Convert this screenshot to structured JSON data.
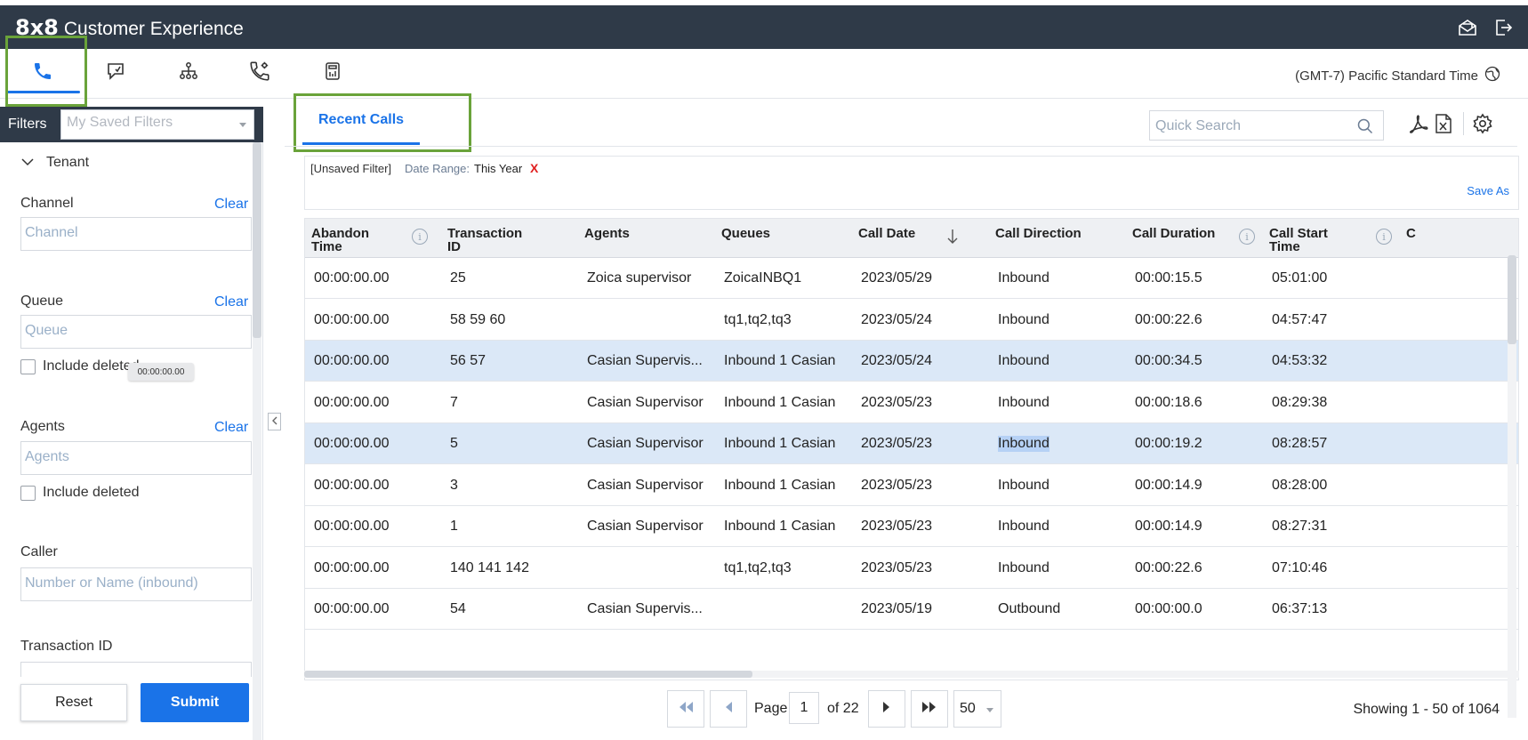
{
  "app": {
    "logo": "8x8",
    "product": "Customer Experience"
  },
  "timezone": "(GMT-7) Pacific Standard Time",
  "icons": {
    "top_right": [
      "mail-open-icon",
      "logout-icon"
    ],
    "tabs": [
      "phone-icon",
      "chat-icon",
      "org-chart-icon",
      "phone-settings-icon",
      "calculator-icon"
    ]
  },
  "accent": "#1a73e8",
  "highlight_box_color": "#6aa33a",
  "sidebar": {
    "filters_label": "Filters",
    "saved_filters_placeholder": "My Saved Filters",
    "tenant_label": "Tenant",
    "channel": {
      "label": "Channel",
      "clear": "Clear",
      "placeholder": "Channel"
    },
    "queue": {
      "label": "Queue",
      "clear": "Clear",
      "placeholder": "Queue",
      "include_deleted": "Include deleted"
    },
    "agents": {
      "label": "Agents",
      "clear": "Clear",
      "placeholder": "Agents",
      "include_deleted": "Include deleted"
    },
    "caller": {
      "label": "Caller",
      "placeholder": "Number or Name (inbound)"
    },
    "transaction_id": {
      "label": "Transaction ID"
    },
    "reset": "Reset",
    "submit": "Submit"
  },
  "main": {
    "tab": "Recent Calls",
    "quick_search_placeholder": "Quick Search",
    "filter": {
      "unsaved": "[Unsaved Filter]",
      "date_range_label": "Date Range:",
      "date_range_value": "This Year",
      "remove": "X",
      "save_as": "Save As"
    },
    "columns": [
      {
        "l1": "Abandon",
        "l2": "Time",
        "info": true
      },
      {
        "l1": "Transaction",
        "l2": "ID",
        "info": false
      },
      {
        "l1": "Agents",
        "l2": "",
        "info": false
      },
      {
        "l1": "Queues",
        "l2": "",
        "info": false
      },
      {
        "l1": "Call Date",
        "l2": "",
        "info": false,
        "sort": "desc"
      },
      {
        "l1": "Call Direction",
        "l2": "",
        "info": false
      },
      {
        "l1": "Call Duration",
        "l2": "",
        "info": true
      },
      {
        "l1": "Call Start",
        "l2": "Time",
        "info": true
      },
      {
        "l1": "C",
        "l2": "",
        "info": false
      }
    ],
    "rows": [
      [
        "00:00:00.00",
        "25",
        "Zoica supervisor",
        "ZoicaINBQ1",
        "2023/05/29",
        "Inbound",
        "00:00:15.5",
        "05:01:00"
      ],
      [
        "00:00:00.00",
        "58 59 60",
        "",
        "tq1,tq2,tq3",
        "2023/05/24",
        "Inbound",
        "00:00:22.6",
        "04:57:47"
      ],
      [
        "00:00:00.00",
        "56 57",
        "Casian Supervis...",
        "Inbound 1 Casian",
        "2023/05/24",
        "Inbound",
        "00:00:34.5",
        "04:53:32"
      ],
      [
        "00:00:00.00",
        "7",
        "Casian Supervisor",
        "Inbound 1 Casian",
        "2023/05/23",
        "Inbound",
        "00:00:18.6",
        "08:29:38"
      ],
      [
        "00:00:00.00",
        "5",
        "Casian Supervisor",
        "Inbound 1 Casian",
        "2023/05/23",
        "Inbound",
        "00:00:19.2",
        "08:28:57"
      ],
      [
        "00:00:00.00",
        "3",
        "Casian Supervisor",
        "Inbound 1 Casian",
        "2023/05/23",
        "Inbound",
        "00:00:14.9",
        "08:28:00"
      ],
      [
        "00:00:00.00",
        "1",
        "Casian Supervisor",
        "Inbound 1 Casian",
        "2023/05/23",
        "Inbound",
        "00:00:14.9",
        "08:27:31"
      ],
      [
        "00:00:00.00",
        "140 141 142",
        "",
        "tq1,tq2,tq3",
        "2023/05/23",
        "Inbound",
        "00:00:22.6",
        "07:10:46"
      ],
      [
        "00:00:00.00",
        "54",
        "Casian Supervis...",
        "",
        "2023/05/19",
        "Outbound",
        "00:00:00.0",
        "06:37:13"
      ]
    ],
    "selected_rows": [
      2,
      4
    ],
    "tooltip": "00:00:00.00",
    "pager": {
      "page_label": "Page",
      "page": "1",
      "of": "of 22",
      "page_size": "50",
      "showing": "Showing 1 - 50 of 1064"
    }
  }
}
